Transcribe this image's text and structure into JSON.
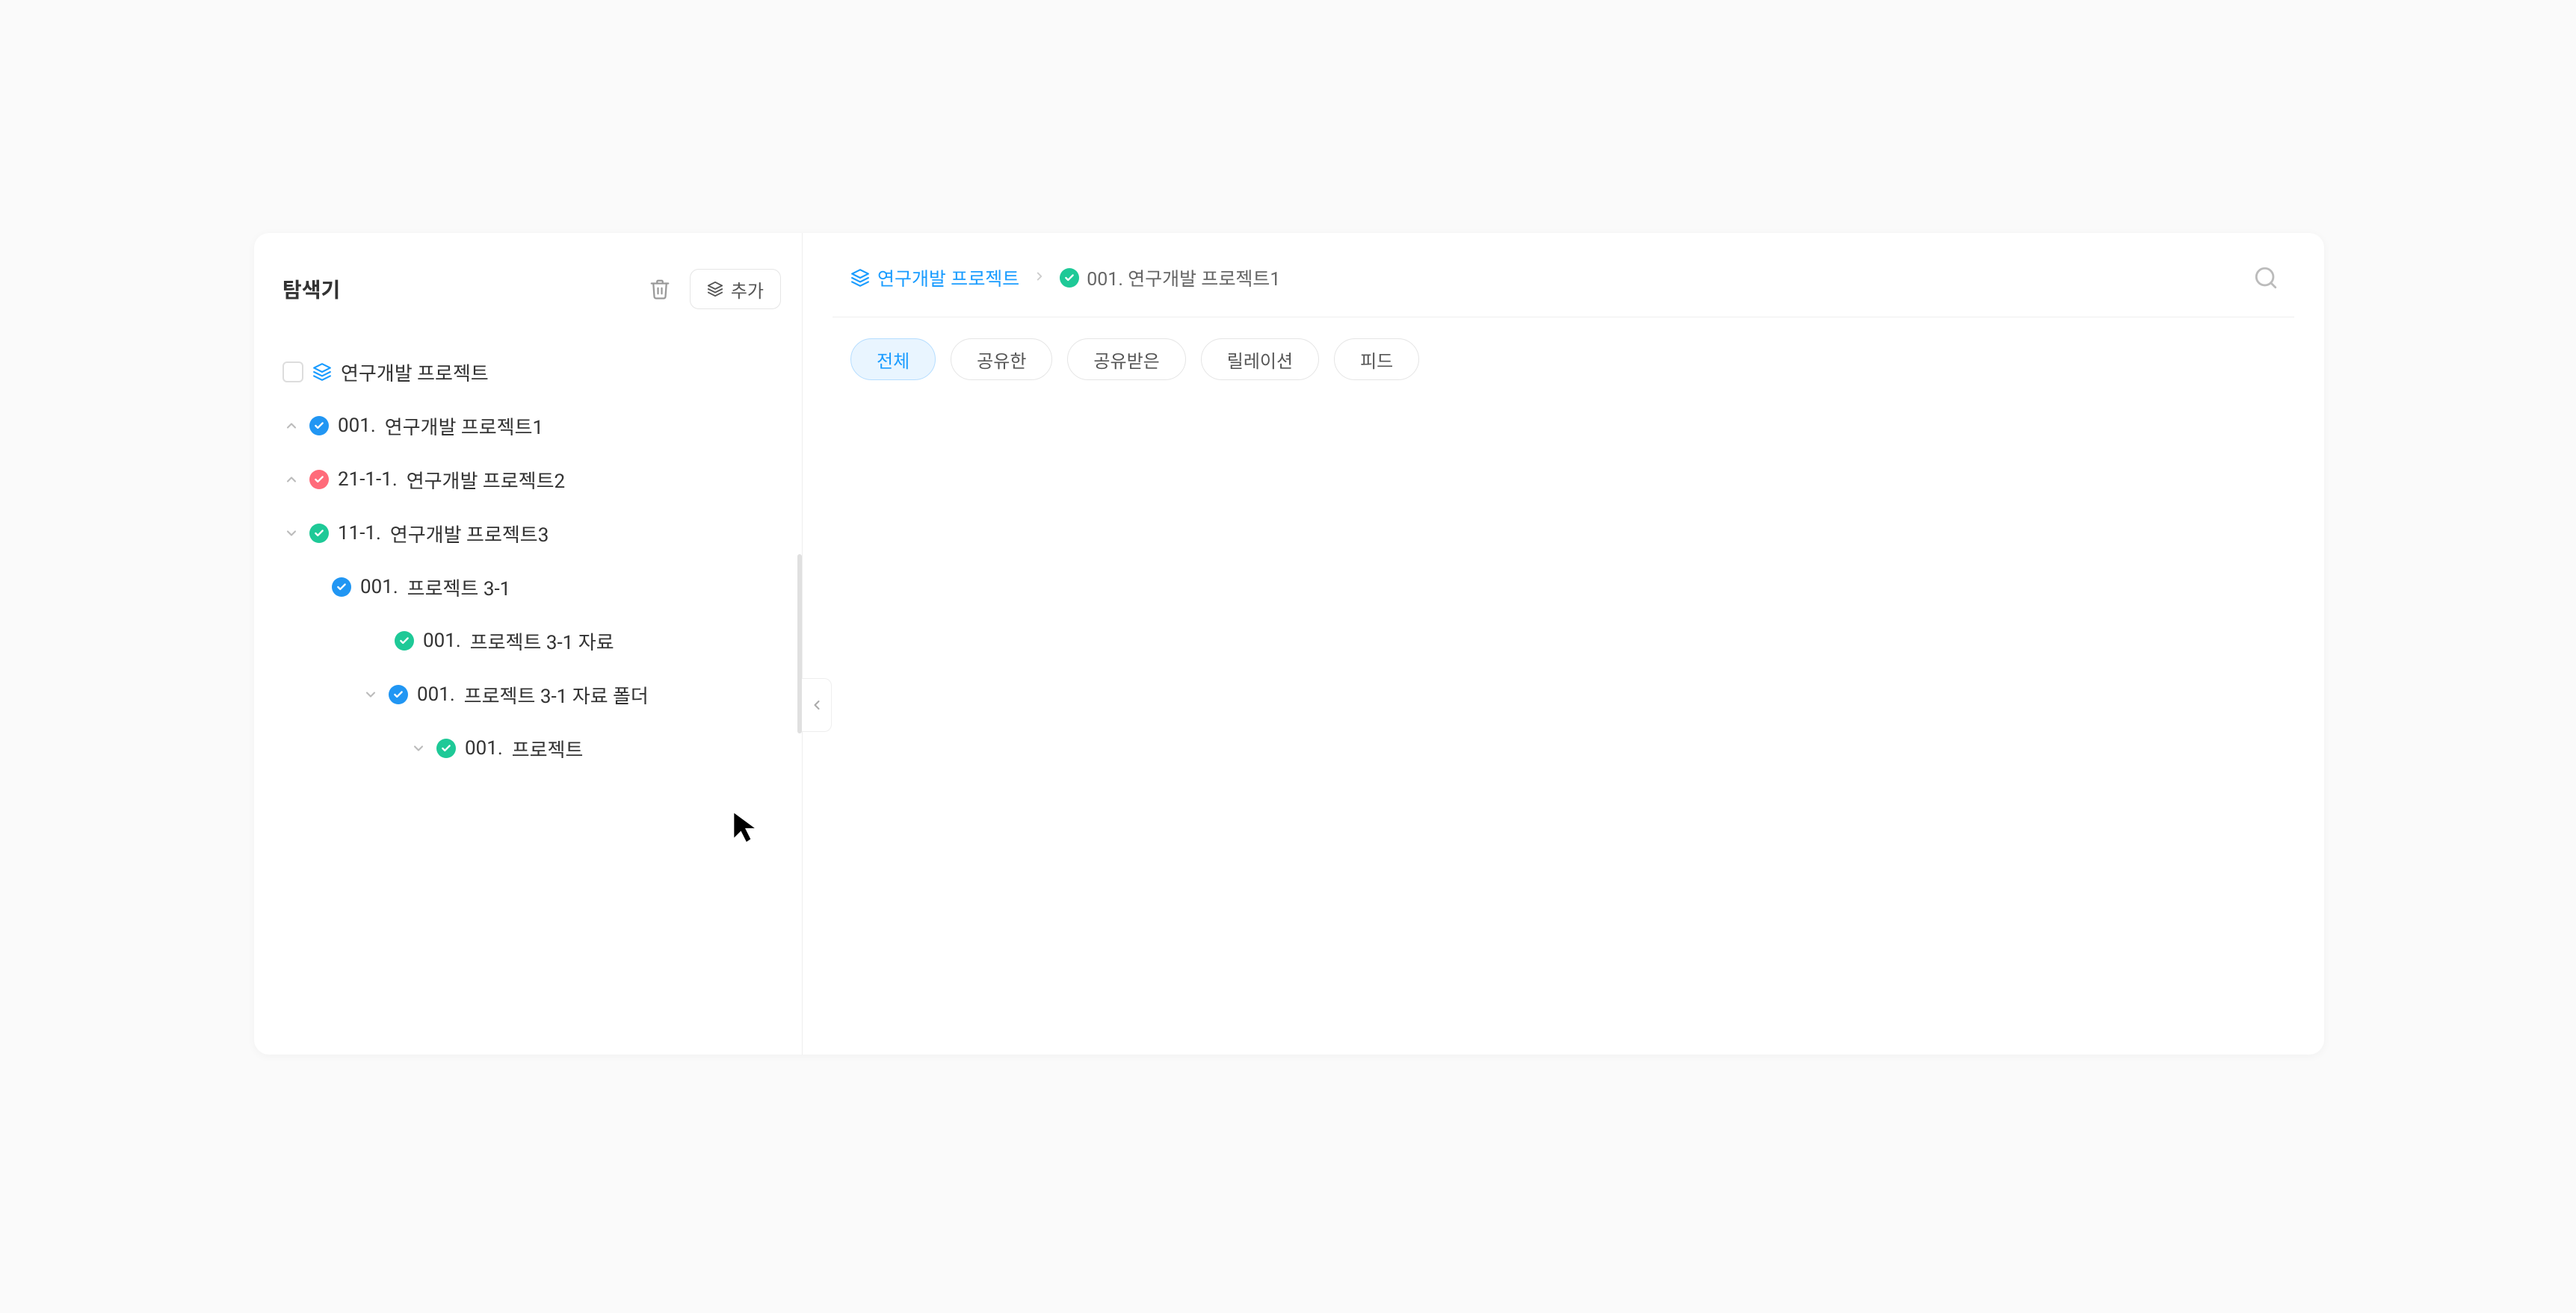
{
  "sidebar": {
    "title": "탐색기",
    "add_label": "추가",
    "root": {
      "label": "연구개발 프로젝트"
    },
    "items": [
      {
        "code": "001.",
        "label": "연구개발 프로젝트1",
        "status": "blue",
        "expanded": false,
        "chevron": "up"
      },
      {
        "code": "21-1-1.",
        "label": "연구개발 프로젝트2",
        "status": "red",
        "expanded": false,
        "chevron": "up"
      },
      {
        "code": "11-1.",
        "label": "연구개발 프로젝트3",
        "status": "green",
        "expanded": true,
        "chevron": "down"
      }
    ],
    "subitems": {
      "proj31": {
        "code": "001.",
        "label": "프로젝트 3-1",
        "status": "blue"
      },
      "proj31data": {
        "code": "001.",
        "label": "프로젝트 3-1 자료",
        "status": "green"
      },
      "proj31folder": {
        "code": "001.",
        "label": "프로젝트 3-1 자료 폴더",
        "status": "blue"
      },
      "proj": {
        "code": "001.",
        "label": "프로젝트",
        "status": "green"
      }
    }
  },
  "breadcrumb": {
    "root": "연구개발 프로젝트",
    "current": "001. 연구개발 프로젝트1"
  },
  "tabs": [
    {
      "label": "전체",
      "active": true
    },
    {
      "label": "공유한",
      "active": false
    },
    {
      "label": "공유받은",
      "active": false
    },
    {
      "label": "릴레이션",
      "active": false
    },
    {
      "label": "피드",
      "active": false
    }
  ]
}
